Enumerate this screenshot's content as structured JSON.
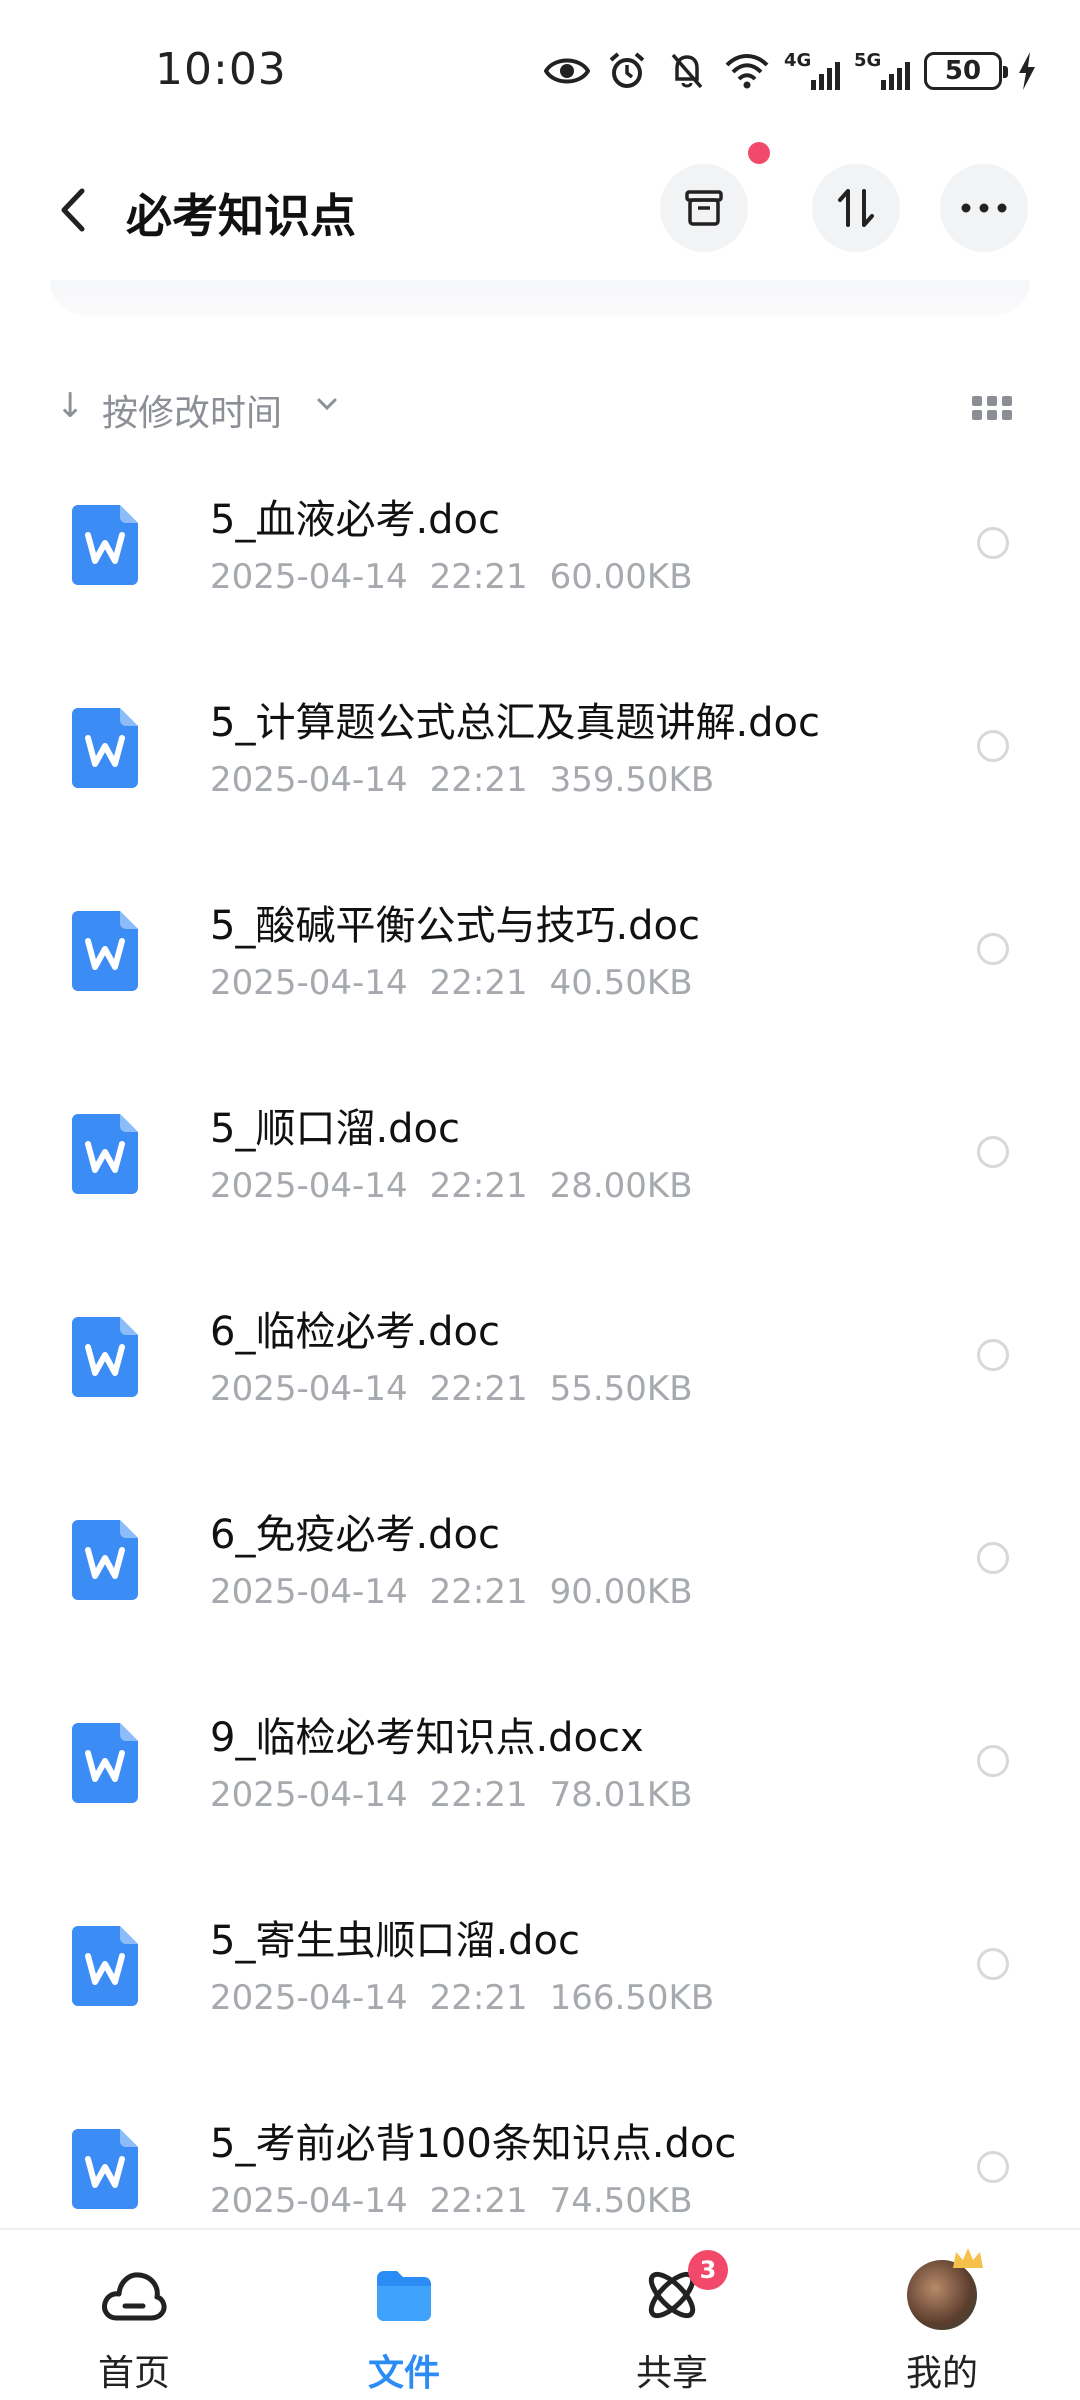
{
  "status": {
    "time": "10:03",
    "net1": "4G",
    "net2": "5G",
    "battery": "50"
  },
  "header": {
    "title": "必考知识点"
  },
  "sort": {
    "label": "按修改时间"
  },
  "files": [
    {
      "name": "5_血液必考.doc",
      "date": "2025-04-14",
      "time": "22:21",
      "size": "60.00KB"
    },
    {
      "name": "5_计算题公式总汇及真题讲解.doc",
      "date": "2025-04-14",
      "time": "22:21",
      "size": "359.50KB"
    },
    {
      "name": "5_酸碱平衡公式与技巧.doc",
      "date": "2025-04-14",
      "time": "22:21",
      "size": "40.50KB"
    },
    {
      "name": "5_顺口溜.doc",
      "date": "2025-04-14",
      "time": "22:21",
      "size": "28.00KB"
    },
    {
      "name": "6_临检必考.doc",
      "date": "2025-04-14",
      "time": "22:21",
      "size": "55.50KB"
    },
    {
      "name": "6_免疫必考.doc",
      "date": "2025-04-14",
      "time": "22:21",
      "size": "90.00KB"
    },
    {
      "name": "9_临检必考知识点.docx",
      "date": "2025-04-14",
      "time": "22:21",
      "size": "78.01KB"
    },
    {
      "name": "5_寄生虫顺口溜.doc",
      "date": "2025-04-14",
      "time": "22:21",
      "size": "166.50KB"
    },
    {
      "name": "5_考前必背100条知识点.doc",
      "date": "2025-04-14",
      "time": "22:21",
      "size": "74.50KB"
    }
  ],
  "nav": {
    "home": "首页",
    "files": "文件",
    "share": "共享",
    "share_badge": "3",
    "mine": "我的"
  },
  "colors": {
    "accent": "#2b8cf6",
    "badge": "#f2496a",
    "doc_icon": "#3b8df5"
  }
}
